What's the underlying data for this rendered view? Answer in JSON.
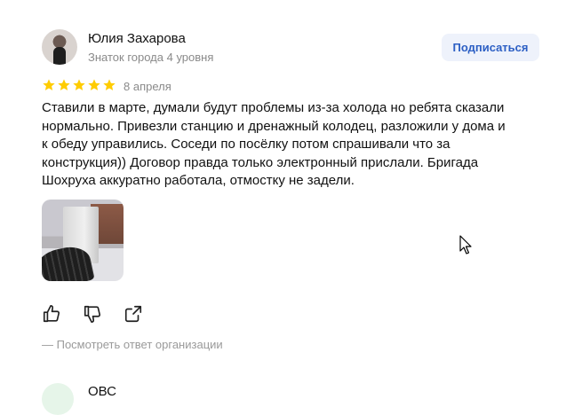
{
  "review": {
    "author_name": "Юлия Захарова",
    "author_level": "Знаток города 4 уровня",
    "subscribe_label": "Подписаться",
    "rating": 5,
    "rating_max": 5,
    "date": "8 апреля",
    "text": "Ставили в марте, думали будут проблемы из-за холода но ребята сказали\nнормально. Привезли станцию и дренажный колодец, разложили у дома и\nк обеду управились. Соседи по посёлку потом спрашивали что за\nконструкция)) Договор правда только электронный прислали. Бригада\nШохруха аккуратно работала, отмостку не задели.",
    "actions": [
      "thumb-up-icon",
      "thumb-down-icon",
      "share-icon"
    ],
    "org_answer_link": "— Посмотреть ответ организации"
  },
  "next_review": {
    "author_name": "ОВС"
  },
  "colors": {
    "star": "#ffcc00",
    "subscribe_bg": "#eef2fb",
    "subscribe_text": "#2c5fc4",
    "secondary_text": "#8a8a8a"
  }
}
